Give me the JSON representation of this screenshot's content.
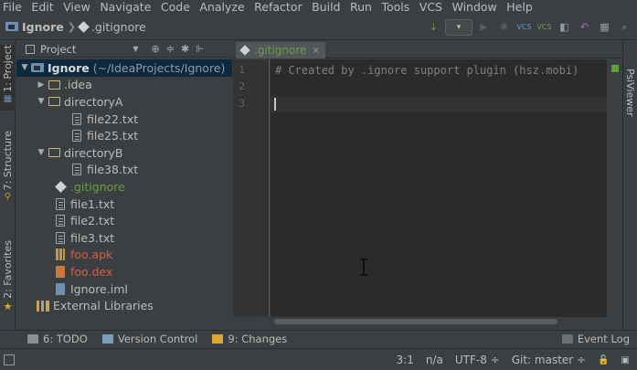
{
  "menu": [
    "File",
    "Edit",
    "View",
    "Navigate",
    "Code",
    "Analyze",
    "Refactor",
    "Build",
    "Run",
    "Tools",
    "VCS",
    "Window",
    "Help"
  ],
  "navbar": {
    "project_crumb": "Ignore",
    "file_crumb": ".gitignore"
  },
  "left_stripe": {
    "project_tab": "1: Project",
    "structure_tab": "7: Structure",
    "favorites_tab": "2: Favorites"
  },
  "project_panel": {
    "title": "Project",
    "root_label": "Ignore",
    "root_path": "(~/IdeaProjects/Ignore)",
    "tree": [
      {
        "label": ".idea"
      },
      {
        "label": "directoryA"
      },
      {
        "label": "file22.txt"
      },
      {
        "label": "file25.txt"
      },
      {
        "label": "directoryB"
      },
      {
        "label": "file38.txt"
      },
      {
        "label": ".gitignore"
      },
      {
        "label": "file1.txt"
      },
      {
        "label": "file2.txt"
      },
      {
        "label": "file3.txt"
      },
      {
        "label": "foo.apk"
      },
      {
        "label": "foo.dex"
      },
      {
        "label": "Ignore.iml"
      },
      {
        "label": "External Libraries"
      }
    ]
  },
  "editor": {
    "tab_label": ".gitignore",
    "line_numbers": [
      "1",
      "2",
      "3"
    ],
    "line1": "# Created by .ignore support plugin (hsz.mobi)"
  },
  "right_stripe": {
    "tab": "PsiViewer"
  },
  "bottom_tools": {
    "todo": "6: TODO",
    "version_control": "Version Control",
    "changes": "9: Changes",
    "event_log": "Event Log"
  },
  "status": {
    "position": "3:1",
    "line_sep": "n/a",
    "encoding": "UTF-8 ÷",
    "git": "Git: master ÷"
  },
  "colors": {
    "selection": "#0d293e",
    "ignored_file": "#d06046",
    "added_file": "#6a9c4a",
    "editor_bg": "#2b2b2b"
  }
}
